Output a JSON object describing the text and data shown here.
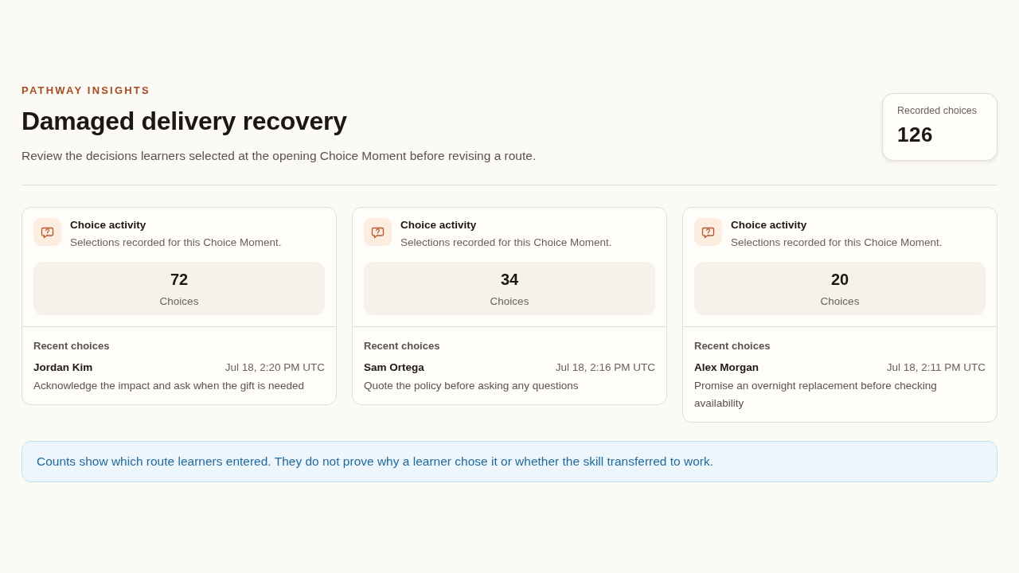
{
  "header": {
    "eyebrow": "PATHWAY INSIGHTS",
    "title": "Damaged delivery recovery",
    "subtitle": "Review the decisions learners selected at the opening Choice Moment before revising a route."
  },
  "summary": {
    "label": "Recorded choices",
    "value": "126"
  },
  "cards": [
    {
      "title": "Choice activity",
      "description": "Selections recorded for this Choice Moment.",
      "count": "72",
      "count_label": "Choices",
      "recent_heading": "Recent choices",
      "recent": [
        {
          "name": "Jordan Kim",
          "time": "Jul 18, 2:20 PM UTC",
          "choice": "Acknowledge the impact and ask when the gift is needed"
        }
      ]
    },
    {
      "title": "Choice activity",
      "description": "Selections recorded for this Choice Moment.",
      "count": "34",
      "count_label": "Choices",
      "recent_heading": "Recent choices",
      "recent": [
        {
          "name": "Sam Ortega",
          "time": "Jul 18, 2:16 PM UTC",
          "choice": "Quote the policy before asking any questions"
        }
      ]
    },
    {
      "title": "Choice activity",
      "description": "Selections recorded for this Choice Moment.",
      "count": "20",
      "count_label": "Choices",
      "recent_heading": "Recent choices",
      "recent": [
        {
          "name": "Alex Morgan",
          "time": "Jul 18, 2:11 PM UTC",
          "choice": "Promise an overnight replacement before checking availability"
        }
      ]
    }
  ],
  "note": "Counts show which route learners entered. They do not prove why a learner chose it or whether the skill transferred to work."
}
